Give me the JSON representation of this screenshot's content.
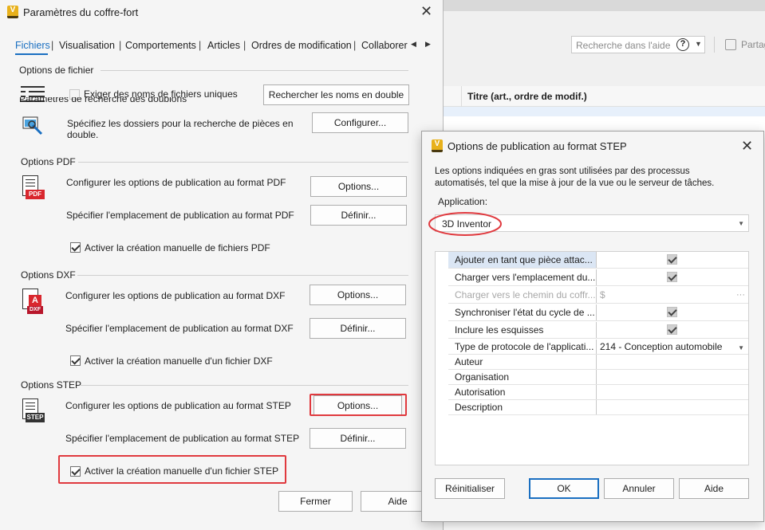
{
  "background": {
    "search_placeholder": "Recherche dans l'aide",
    "help_icon": "question-circle-icon",
    "share_label": "Partager",
    "grid_column_title": "Titre (art., ordre de modif.)"
  },
  "main_dialog": {
    "title": "Paramètres du coffre-fort",
    "app_icon_letter": "V",
    "close_glyph": "✕",
    "tabs": [
      {
        "label": "Fichiers",
        "active": true
      },
      {
        "label": "Visualisation"
      },
      {
        "label": "Comportements"
      },
      {
        "label": "Articles"
      },
      {
        "label": "Ordres de modification"
      },
      {
        "label": "Collaborer"
      }
    ],
    "tab_sep": "|",
    "tab_left_arrow": "◀",
    "tab_right_arrow": "▶",
    "file_options": {
      "label": "Options de fichier",
      "unique_names_label": "Exiger des noms de fichiers uniques",
      "find_duplicates_button": "Rechercher les noms en double",
      "duplicate_search_label": "Paramètres de recherche des doublons",
      "folders_text_line1": "Spécifiez les dossiers pour la recherche de pièces en",
      "folders_text_line2": "double.",
      "configure_button": "Configurer..."
    },
    "pdf": {
      "label": "Options PDF",
      "badge": "PDF",
      "configure_text": "Configurer les options de publication au format PDF",
      "options_button": "Options...",
      "location_text": "Spécifier l'emplacement de publication au format PDF",
      "define_button": "Définir...",
      "manual_label": "Activer la création manuelle de fichiers PDF"
    },
    "dxf": {
      "label": "Options DXF",
      "badge": "DXF",
      "badge_letter": "A",
      "configure_text": "Configurer les options de publication au format DXF",
      "options_button": "Options...",
      "location_text": "Spécifier l'emplacement de publication au format DXF",
      "define_button": "Définir...",
      "manual_label": "Activer la création manuelle d'un fichier DXF"
    },
    "step": {
      "label": "Options STEP",
      "badge": "STEP",
      "configure_text": "Configurer les options de publication au format STEP",
      "options_button": "Options...",
      "location_text": "Spécifier l'emplacement de publication au format STEP",
      "define_button": "Définir...",
      "manual_label": "Activer la création manuelle d'un fichier STEP"
    },
    "close_button": "Fermer",
    "help_button": "Aide"
  },
  "step_dialog": {
    "title": "Options de publication au format STEP",
    "app_icon_letter": "V",
    "close_glyph": "✕",
    "info_line1": "Les options indiquées en gras sont utilisées par des processus",
    "info_line2": "automatisés, tel que la mise à jour de la vue ou le serveur de tâches.",
    "application_label": "Application:",
    "application_value": "3D Inventor",
    "dropdown_glyph": "▼",
    "ellipsis_glyph": "···",
    "properties": [
      {
        "name": "Ajouter en tant que pièce attac...",
        "type": "checkbox",
        "checked": true,
        "selected": true
      },
      {
        "name": "Charger vers l'emplacement du...",
        "type": "checkbox",
        "checked": true
      },
      {
        "name": "Charger vers le chemin du coffr...",
        "type": "path",
        "value": "$",
        "disabled": true
      },
      {
        "name": "Synchroniser l'état du cycle de ...",
        "type": "checkbox",
        "checked": true
      },
      {
        "name": "Inclure les esquisses",
        "type": "checkbox",
        "checked": true
      },
      {
        "name": "Type de protocole de l'applicati...",
        "type": "dropdown",
        "value": "214 - Conception automobile"
      },
      {
        "name": "Auteur",
        "type": "text",
        "value": ""
      },
      {
        "name": "Organisation",
        "type": "text",
        "value": ""
      },
      {
        "name": "Autorisation",
        "type": "text",
        "value": ""
      },
      {
        "name": "Description",
        "type": "text",
        "value": ""
      }
    ],
    "reset_button": "Réinitialiser",
    "ok_button": "OK",
    "cancel_button": "Annuler",
    "help_button": "Aide"
  },
  "colors": {
    "accent": "#1a6fc1",
    "highlight": "#e0393e",
    "selected_row": "#dbe6f4"
  }
}
